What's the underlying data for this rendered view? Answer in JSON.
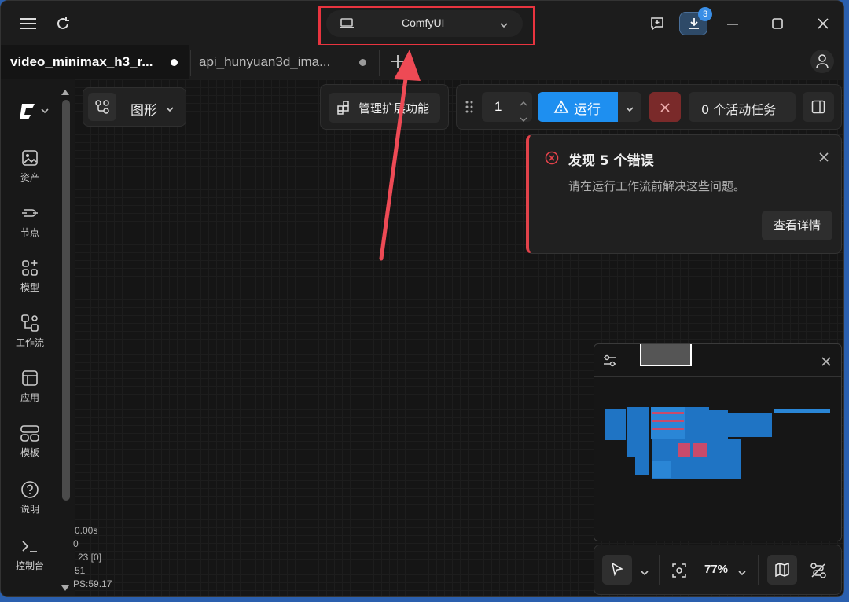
{
  "titlebar": {
    "workspace_select": "ComfyUI",
    "download_badge": "3"
  },
  "tabs": [
    {
      "label": "video_minimax_h3_r...",
      "active": true
    },
    {
      "label": "api_hunyuan3d_ima...",
      "active": false
    }
  ],
  "sidebar": {
    "items": [
      {
        "label": "资产",
        "icon": "image-icon"
      },
      {
        "label": "节点",
        "icon": "node-icon"
      },
      {
        "label": "模型",
        "icon": "model-icon"
      },
      {
        "label": "工作流",
        "icon": "workflow-icon"
      },
      {
        "label": "应用",
        "icon": "app-icon"
      },
      {
        "label": "模板",
        "icon": "template-icon"
      },
      {
        "label": "说明",
        "icon": "help-icon"
      },
      {
        "label": "控制台",
        "icon": "console-icon"
      }
    ]
  },
  "toolbar": {
    "graph_mode": "图形",
    "manage_extensions": "管理扩展功能",
    "queue_count": "1",
    "run_label": "运行",
    "active_tasks": "0 个活动任务"
  },
  "error_toast": {
    "title": "发现 5 个错误",
    "message": "请在运行工作流前解决这些问题。",
    "details_button": "查看详情"
  },
  "stats": {
    "line1": "0.00s",
    "line2": "0",
    "line3": "23 [0]",
    "line4": "51",
    "line5": "PS:59.17"
  },
  "bottom_toolbar": {
    "zoom": "77%"
  },
  "colors": {
    "accent": "#1e8ff0",
    "error": "#e2424a",
    "highlight": "#e8343f"
  }
}
